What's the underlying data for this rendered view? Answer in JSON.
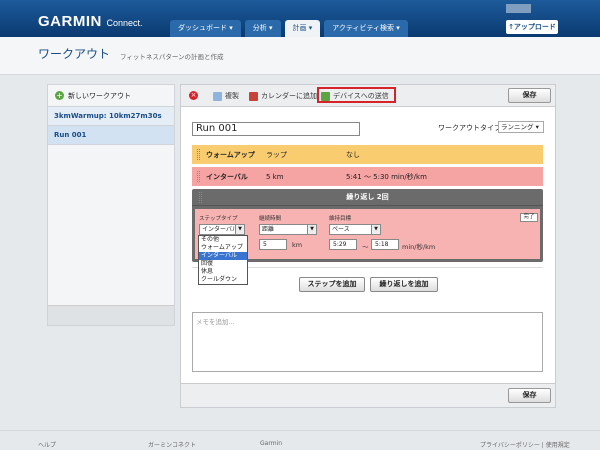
{
  "brand": {
    "logo": "GARMIN",
    "logo_suffix": "Connect.",
    "upload": "↑アップロード"
  },
  "nav": {
    "tabs": [
      "ダッシュボード ▾",
      "分析 ▾",
      "計画 ▾",
      "アクティビティ検索 ▾"
    ],
    "active_index": 2
  },
  "header": {
    "title": "ワークアウト",
    "subtitle": "フィットネスパターンの計画と作成"
  },
  "sidebar": {
    "new_workout": "新しいワークアウト",
    "items": [
      "3kmWarmup: 10km27m30s",
      "Run 001"
    ],
    "active_index": 1
  },
  "toolbar": {
    "copy": "複製",
    "calendar": "カレンダーに追加",
    "send": "デバイスへの送信",
    "save": "保存"
  },
  "workout": {
    "name": "Run 001",
    "type_label": "ワークアウトタイプ:",
    "type_value": "ランニング"
  },
  "steps": [
    {
      "name": "ウォームアップ",
      "duration": "ラップ",
      "target": "なし"
    },
    {
      "name": "インターバル",
      "duration": "5 km",
      "target": "5:41 〜 5:30 min/秒/km"
    }
  ],
  "repeat": {
    "title": "繰り返し 2回",
    "step_type_label": "ステップタイプ",
    "step_type_value": "インターバル",
    "duration_label": "継続時間",
    "duration_value": "距離",
    "distance": "5",
    "distance_unit": "km",
    "target_label": "維持目標",
    "target_value": "ペース",
    "pace_from": "5:29",
    "pace_sep": "〜",
    "pace_to": "5:18",
    "pace_unit": "min/秒/km",
    "done": "完了",
    "dropdown_options": [
      "その他",
      "ウォームアップ",
      "インターバル",
      "回復",
      "休息",
      "クールダウン"
    ],
    "dropdown_selected": 2
  },
  "actions": {
    "add_step": "ステップを追加",
    "add_repeat": "繰り返しを追加"
  },
  "memo": {
    "placeholder": "メモを追加..."
  },
  "footer": {
    "help": "ヘルプ",
    "community": "ガーミンコネクト",
    "garmin": "Garmin",
    "policy": "プライバシーポリシー | 使用規定"
  }
}
